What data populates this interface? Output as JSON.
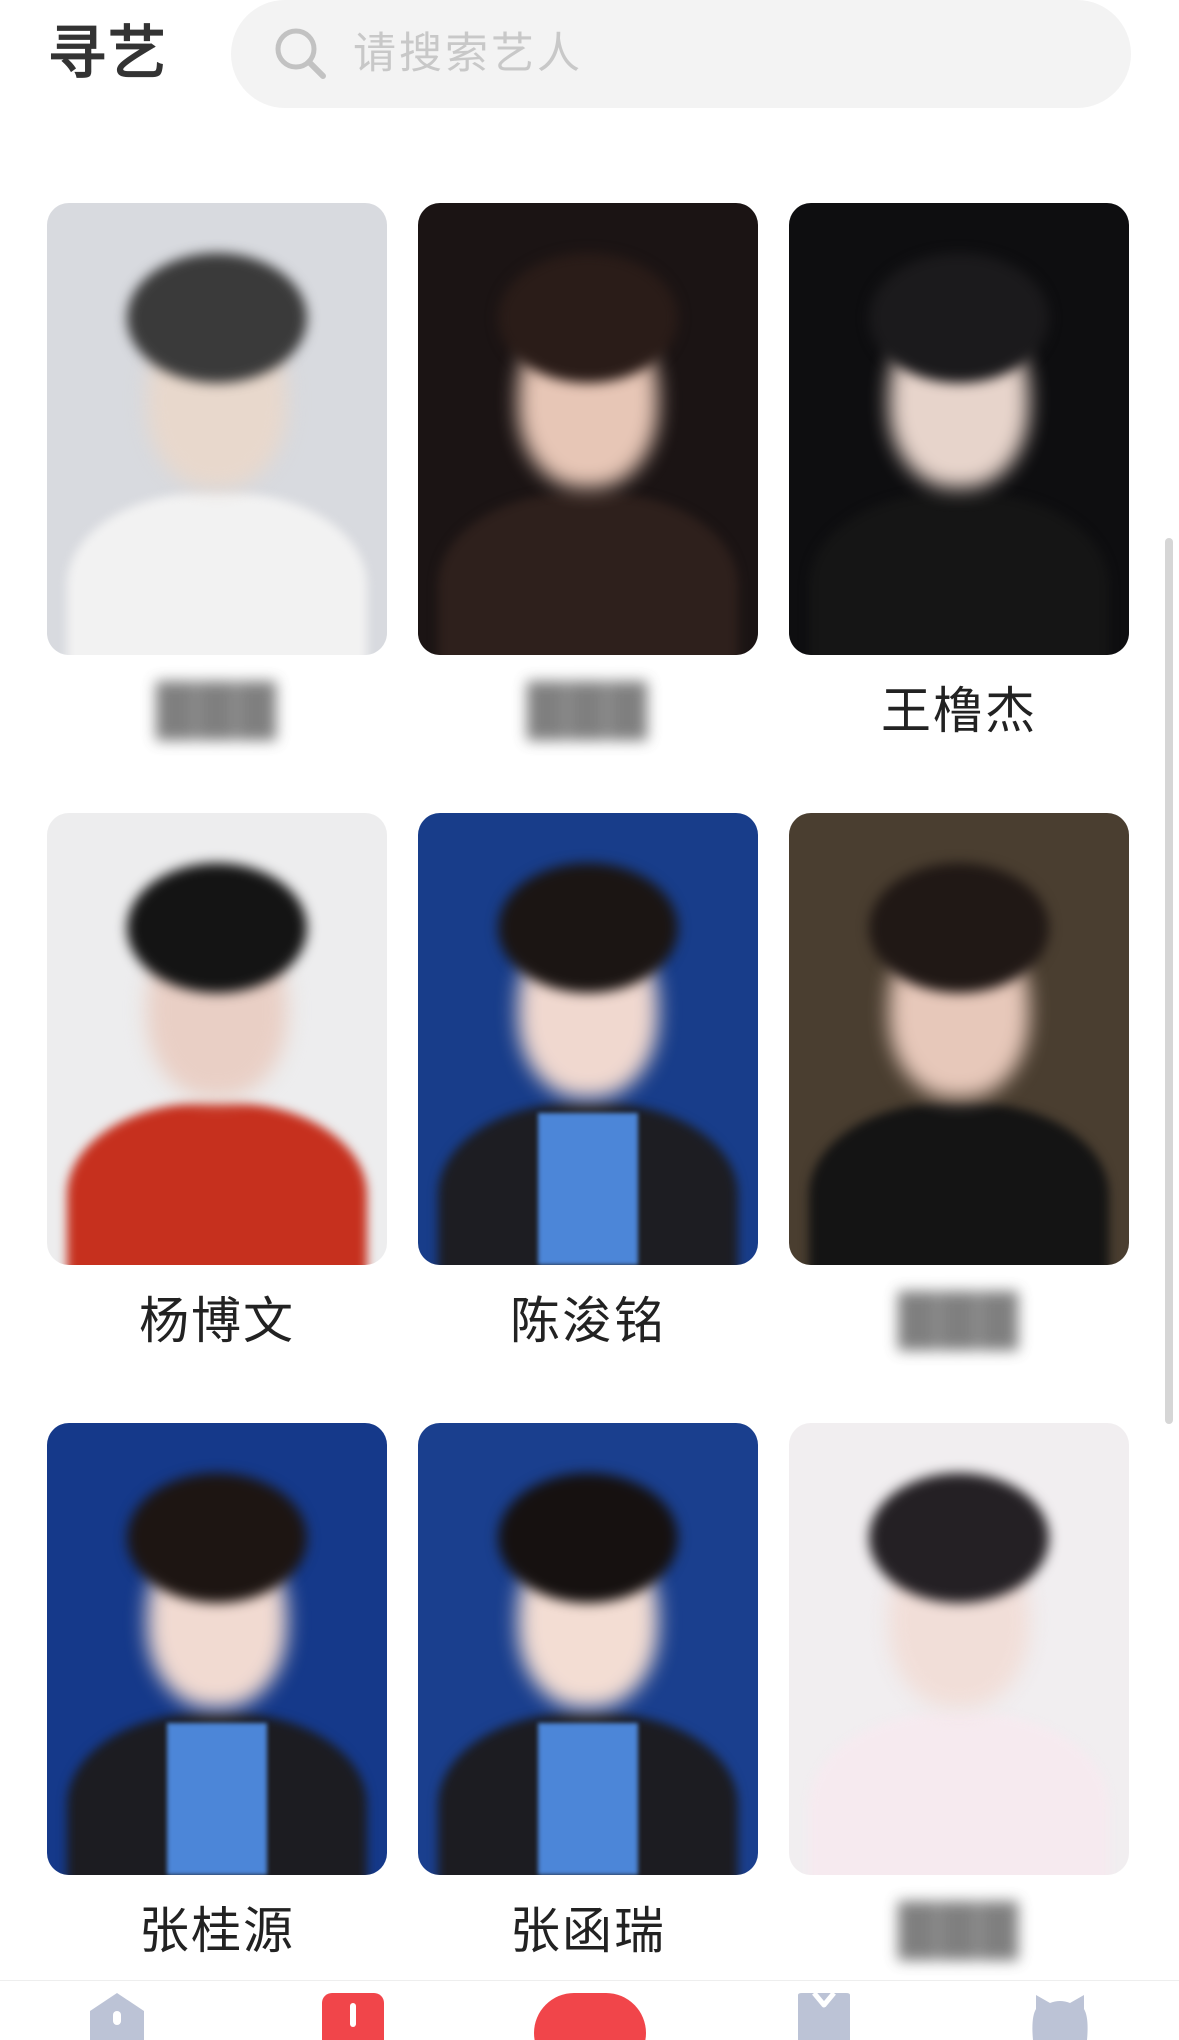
{
  "header": {
    "title": "寻艺",
    "search": {
      "placeholder": "请搜索艺人"
    }
  },
  "artists": [
    {
      "name": "",
      "blurred": true,
      "bg": "#d8dadf",
      "hair": "#3a3a3a",
      "skin": "#e8d8cc",
      "body": "#f2f2f2"
    },
    {
      "name": "",
      "blurred": true,
      "bg": "#1b1414",
      "hair": "#2a1c18",
      "skin": "#e7c6b6",
      "body": "#2e201c"
    },
    {
      "name": "王橹杰",
      "blurred": false,
      "bg": "#0e0e10",
      "hair": "#1b1a1c",
      "skin": "#e7d4cb",
      "body": "#151515"
    },
    {
      "name": "杨博文",
      "blurred": false,
      "bg": "#ededee",
      "hair": "#141414",
      "skin": "#e9cfc5",
      "body": "#c6301e"
    },
    {
      "name": "陈浚铭",
      "blurred": false,
      "bg": "#183d8a",
      "hair": "#1b1513",
      "skin": "#f0d8cf",
      "body": "#1d1d22"
    },
    {
      "name": "",
      "blurred": true,
      "bg": "#4a3e30",
      "hair": "#201815",
      "skin": "#e7c8ba",
      "body": "#141414"
    },
    {
      "name": "张桂源",
      "blurred": false,
      "bg": "#15398a",
      "hair": "#1d1512",
      "skin": "#f1dad1",
      "body": "#1c1c21"
    },
    {
      "name": "张函瑞",
      "blurred": false,
      "bg": "#1a3f8e",
      "hair": "#161110",
      "skin": "#f3ddd3",
      "body": "#1c1c21"
    },
    {
      "name": "",
      "blurred": true,
      "bg": "#f1eef0",
      "hair": "#242024",
      "skin": "#f1ded8",
      "body": "#f6eaef"
    }
  ],
  "colors": {
    "accent": "#f1454a",
    "nav_icon": "#bcc3d6"
  },
  "nav": {
    "items": [
      {
        "icon": "home-icon"
      },
      {
        "icon": "chart-icon"
      },
      {
        "icon": "center-action-icon"
      },
      {
        "icon": "trophy-icon"
      },
      {
        "icon": "profile-icon"
      }
    ]
  }
}
